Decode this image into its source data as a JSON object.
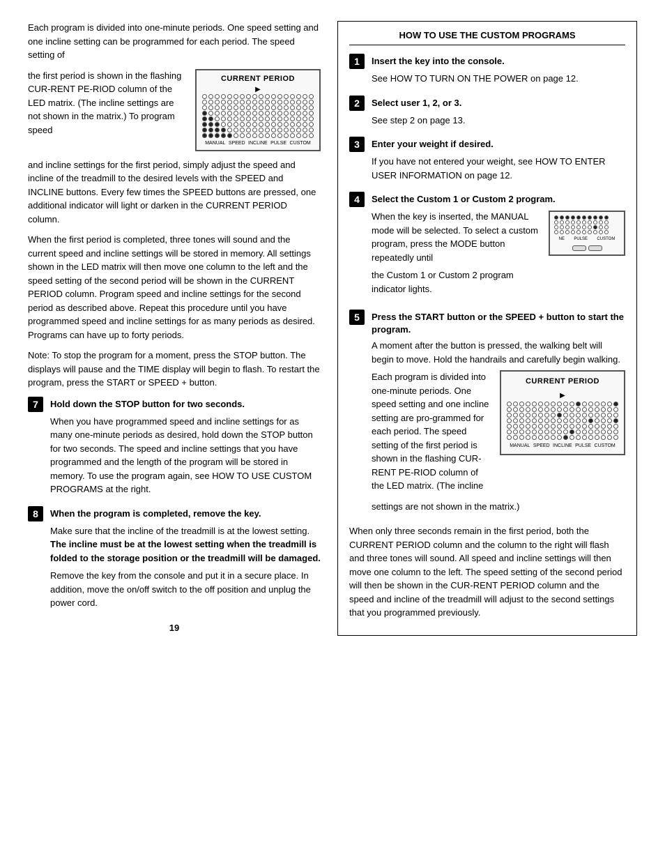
{
  "page_number": "19",
  "left_col": {
    "intro_paragraph": "Each program is divided into one-minute periods. One speed setting and one incline setting can be programmed for each period. The speed setting of",
    "figure_text": "the first period is shown in the flashing CUR-RENT PE-RIOD column of the LED matrix. (The incline settings are not shown in the matrix.) To program speed",
    "figure_title": "CURRENT PERIOD",
    "para2": "and incline settings for the first period, simply adjust the speed and incline of the treadmill to the desired levels with the SPEED and INCLINE buttons. Every few times the SPEED buttons are pressed, one additional indicator will light or darken in the CURRENT PERIOD column.",
    "para3": "When the first period is completed, three tones will sound and the current speed and incline settings will be stored in memory. All settings shown in the LED matrix will then move one column to the left and the speed setting of the second period will be shown in the CURRENT PERIOD column. Program speed and incline settings for the second period as described above. Repeat this procedure until you have programmed speed and incline settings for as many periods as desired. Programs can have up to forty periods.",
    "para4": "Note: To stop the program for a moment, press the STOP button. The displays will pause and the TIME display will begin to flash. To restart the program, press the START or SPEED + button.",
    "step7": {
      "num": "7",
      "title": "Hold down the STOP button for two seconds.",
      "body": "When you have programmed speed and incline settings for as many one-minute periods as desired, hold down the STOP button for two seconds. The speed and incline settings that you have programmed and the length of the program will be stored in memory. To use the program again, see HOW TO USE CUSTOM PROGRAMS at the right."
    },
    "step8": {
      "num": "8",
      "title": "When the program is completed, remove the key.",
      "body1": "Make sure that the incline of the treadmill is at the lowest setting.",
      "body2_bold": "The incline must be at the lowest setting when the treadmill is folded to the storage position or the treadmill will be damaged.",
      "body3": "Remove the key from the console and put it in a secure place. In addition, move the on/off switch to the off position and unplug the power cord."
    }
  },
  "right_col": {
    "title": "HOW TO USE THE CUSTOM PROGRAMS",
    "steps": [
      {
        "num": "1",
        "title": "Insert the key into the console.",
        "body": "See HOW TO TURN ON THE POWER on page 12."
      },
      {
        "num": "2",
        "title": "Select user 1, 2, or 3.",
        "body": "See step 2 on page 13."
      },
      {
        "num": "3",
        "title": "Enter your weight if desired.",
        "body": "If you have not entered your weight, see HOW TO ENTER USER INFORMATION on page 12."
      },
      {
        "num": "4",
        "title": "Select the Custom 1 or Custom 2 program.",
        "body1": "When the key is inserted, the MANUAL mode will be selected. To select a custom program, press the MODE button repeatedly until",
        "body2": "the Custom 1 or Custom 2 program indicator lights.",
        "figure_title": ""
      },
      {
        "num": "5",
        "title": "Press the START button or the SPEED + button to start the program.",
        "body1": "A moment after the button is pressed, the walking belt will begin to move. Hold the handrails and carefully begin walking.",
        "body2": "Each program is divided into one-minute periods. One speed setting and one incline setting are pro-grammed for each period. The speed setting of the first period is shown in the flashing CUR-RENT PE-RIOD column of the LED matrix. (The incline",
        "body3": "settings are not shown in the matrix.)",
        "figure_title": "CURRENT PERIOD"
      }
    ],
    "bottom_para1": "When only three seconds remain in the first period, both the CURRENT PERIOD column and the column to the right will flash and three tones will sound. All speed and incline settings will then move one column to the left. The speed setting of the second period will then be shown in the CUR-RENT PERIOD column and the speed and incline of the treadmill will adjust to the second settings that you programmed previously."
  }
}
